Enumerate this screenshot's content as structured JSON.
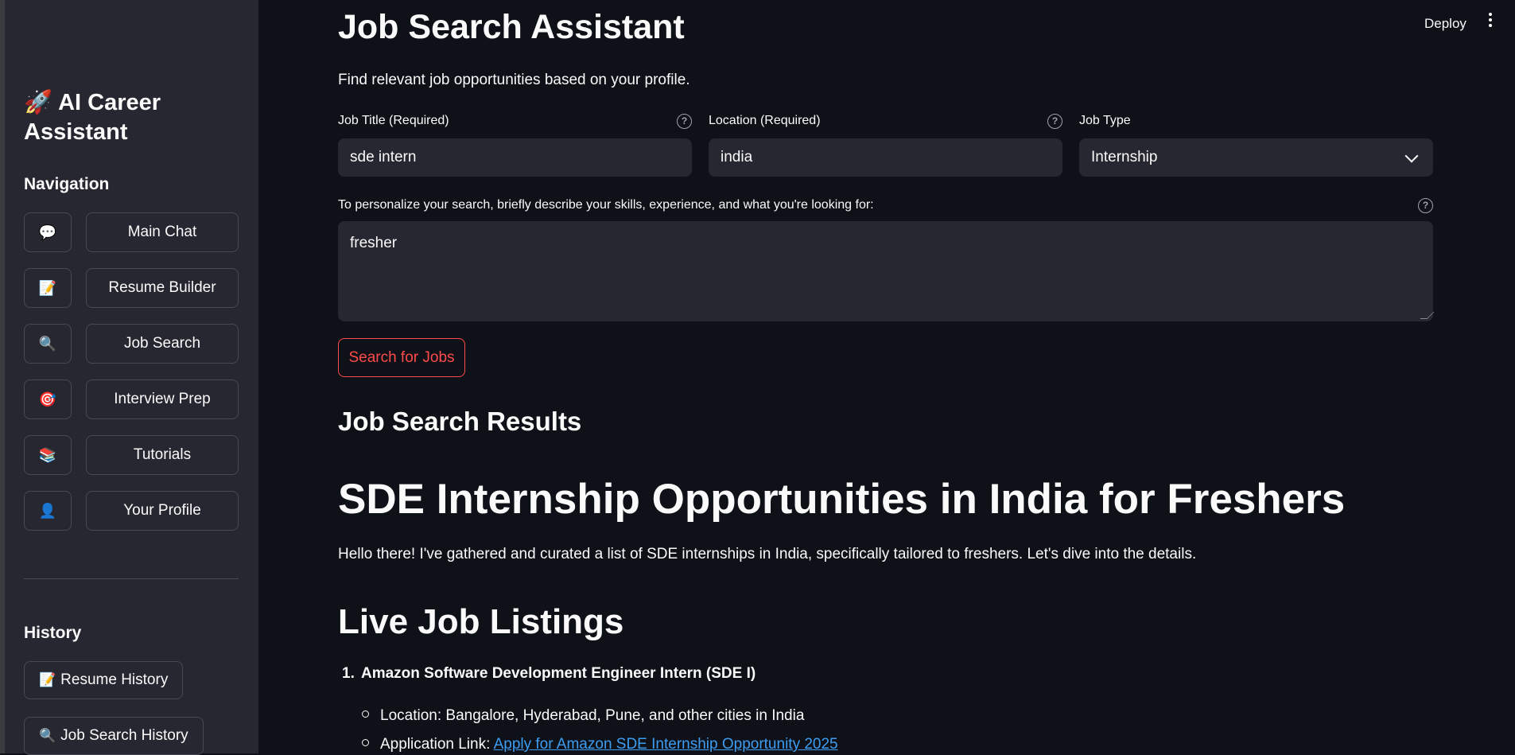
{
  "sidebar": {
    "app_title_icon": "🚀",
    "app_title": "AI Career Assistant",
    "nav_heading": "Navigation",
    "nav_items": [
      {
        "icon": "💬",
        "icon_name": "speech-bubble-icon",
        "label": "Main Chat"
      },
      {
        "icon": "📝",
        "icon_name": "memo-icon",
        "label": "Resume Builder"
      },
      {
        "icon": "🔍",
        "icon_name": "magnifier-icon",
        "label": "Job Search"
      },
      {
        "icon": "🎯",
        "icon_name": "target-icon",
        "label": "Interview Prep"
      },
      {
        "icon": "📚",
        "icon_name": "books-icon",
        "label": "Tutorials"
      },
      {
        "icon": "👤",
        "icon_name": "user-icon",
        "label": "Your Profile"
      }
    ],
    "history_heading": "History",
    "history_items": [
      {
        "icon": "📝",
        "icon_name": "memo-icon",
        "label": "Resume History"
      },
      {
        "icon": "🔍",
        "icon_name": "magnifier-icon",
        "label": "Job Search History"
      }
    ]
  },
  "topbar": {
    "deploy_label": "Deploy"
  },
  "main": {
    "title": "Job Search Assistant",
    "subtitle": "Find relevant job opportunities based on your profile.",
    "job_title_label": "Job Title (Required)",
    "job_title_value": "sde intern",
    "location_label": "Location (Required)",
    "location_value": "india",
    "job_type_label": "Job Type",
    "job_type_value": "Internship",
    "description_label": "To personalize your search, briefly describe your skills, experience, and what you're looking for:",
    "description_value": "fresher",
    "search_button": "Search for Jobs",
    "results_heading": "Job Search Results",
    "results_title": "SDE Internship Opportunities in India for Freshers",
    "results_intro": "Hello there! I've gathered and curated a list of SDE internships in India, specifically tailored to freshers. Let's dive into the details.",
    "live_heading": "Live Job Listings",
    "listing_1_number": "1.",
    "listing_1_title": "Amazon Software Development Engineer Intern (SDE I)",
    "listing_1_location": "Location: Bangalore, Hyderabad, Pune, and other cities in India",
    "listing_1_link_prefix": "Application Link: ",
    "listing_1_link_text": "Apply for Amazon SDE Internship Opportunity 2025"
  },
  "colors": {
    "accent": "#ff4b4b",
    "link": "#3d9df3",
    "background": "#0e1117",
    "sidebar": "#262730"
  }
}
